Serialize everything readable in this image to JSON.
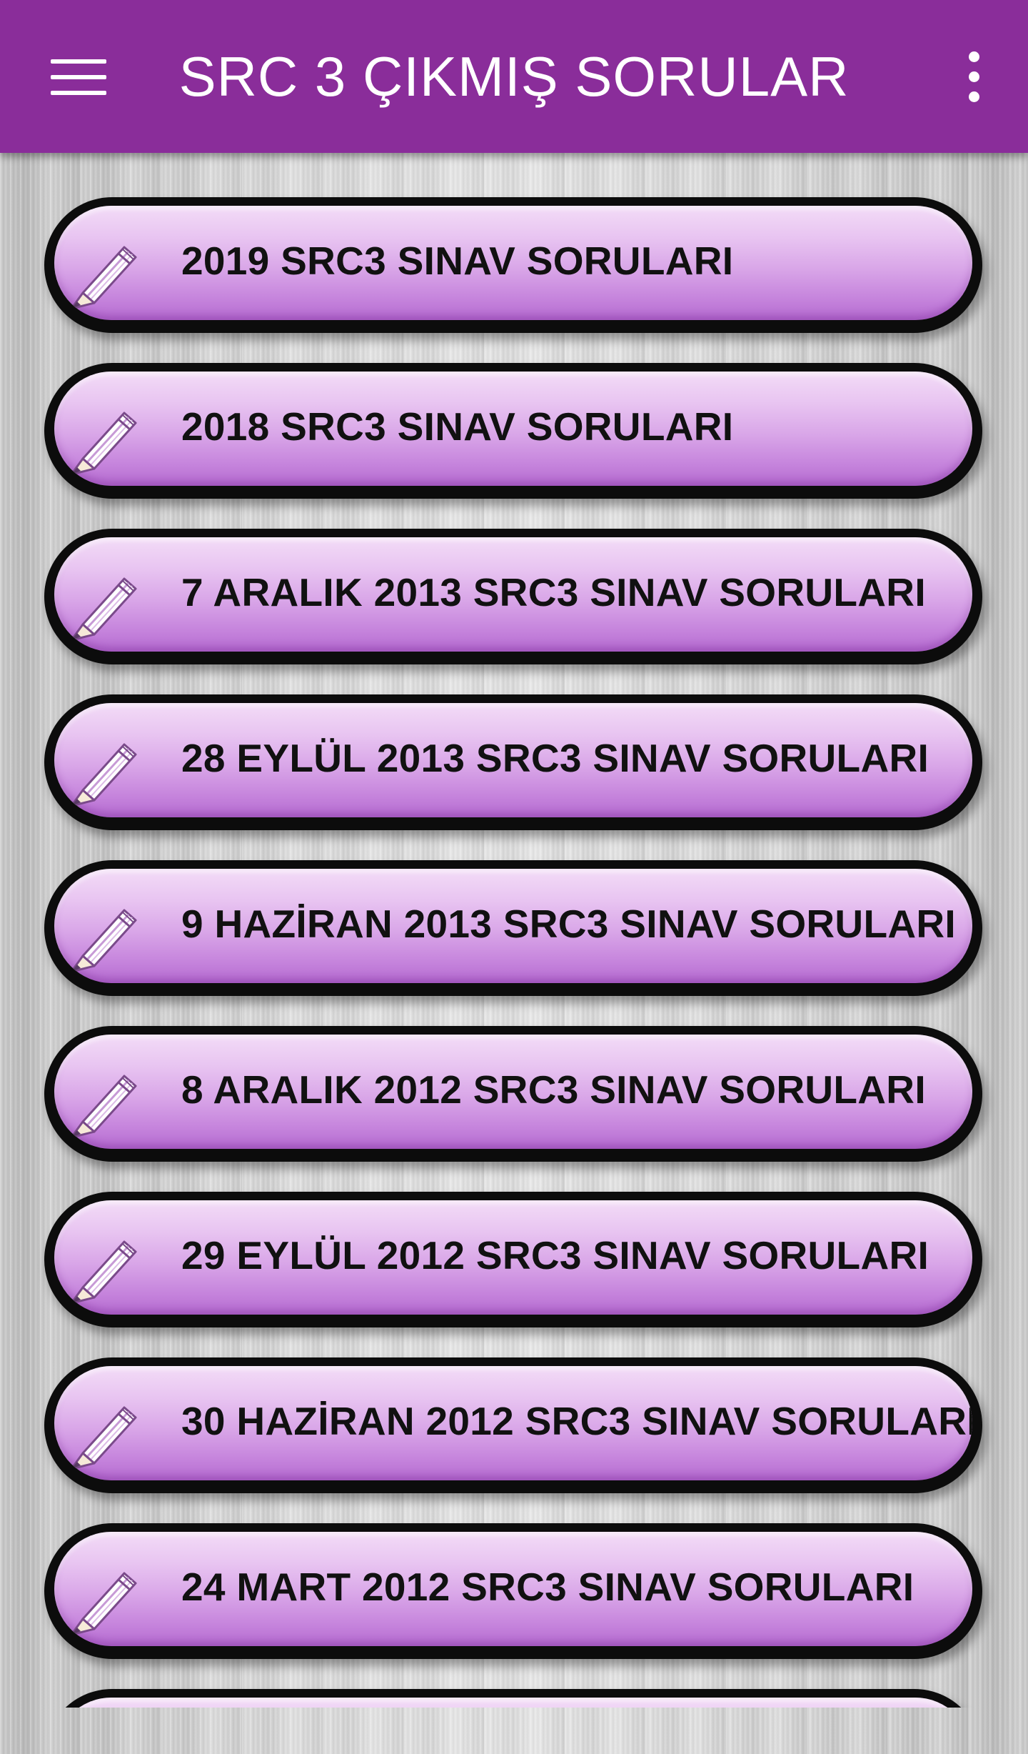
{
  "appbar": {
    "title": "SRC 3 ÇIKMIŞ SORULAR",
    "menu_icon": "hamburger-menu-icon",
    "overflow_icon": "more-vert-icon",
    "color": "#8a2d9a"
  },
  "list": {
    "item_icon": "pencil-icon",
    "items": [
      {
        "label": "2019 SRC3 SINAV SORULARI"
      },
      {
        "label": "2018 SRC3 SINAV SORULARI"
      },
      {
        "label": "7 ARALIK 2013 SRC3 SINAV SORULARI"
      },
      {
        "label": "28 EYLÜL 2013 SRC3 SINAV SORULARI"
      },
      {
        "label": "9 HAZİRAN 2013 SRC3 SINAV SORULARI"
      },
      {
        "label": "8 ARALIK 2012 SRC3 SINAV SORULARI"
      },
      {
        "label": "29 EYLÜL 2012 SRC3 SINAV SORULARI"
      },
      {
        "label": "30 HAZİRAN 2012 SRC3 SINAV SORULARI"
      },
      {
        "label": "24 MART 2012 SRC3 SINAV SORULARI"
      }
    ]
  }
}
